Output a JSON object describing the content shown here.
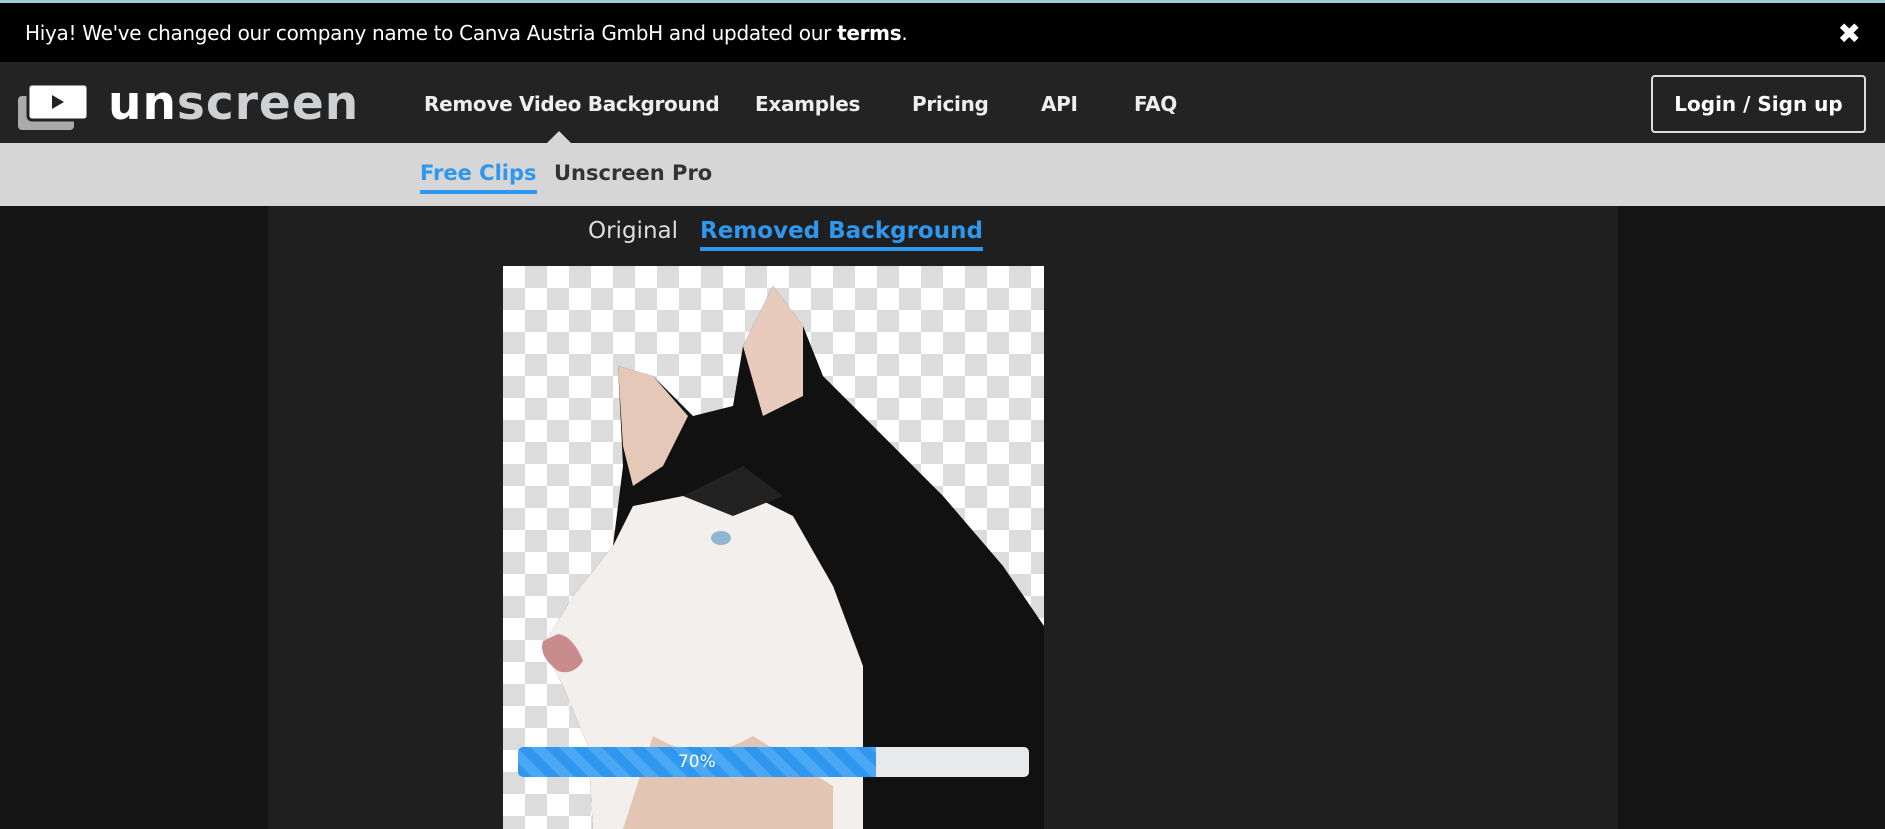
{
  "banner": {
    "text": "Hiya! We've changed our company name to Canva Austria GmbH and updated our ",
    "link": "terms",
    "suffix": ".",
    "close_icon": "close-icon"
  },
  "logo": {
    "part1": "un",
    "part2": "screen"
  },
  "nav": {
    "items": [
      {
        "label": "Remove Video Background"
      },
      {
        "label": "Examples"
      },
      {
        "label": "Pricing"
      },
      {
        "label": "API"
      },
      {
        "label": "FAQ"
      }
    ],
    "login": "Login / Sign up"
  },
  "subnav": {
    "items": [
      {
        "label": "Free Clips",
        "active": true
      },
      {
        "label": "Unscreen Pro",
        "active": false
      }
    ]
  },
  "view_toggle": {
    "original": "Original",
    "removed": "Removed Background",
    "active": "Removed Background"
  },
  "progress": {
    "value": 70,
    "label": "70%"
  },
  "colors": {
    "accent": "#2f97ee",
    "banner_bg": "#000000",
    "nav_bg": "#232323",
    "subnav_bg": "#d6d6d6"
  }
}
